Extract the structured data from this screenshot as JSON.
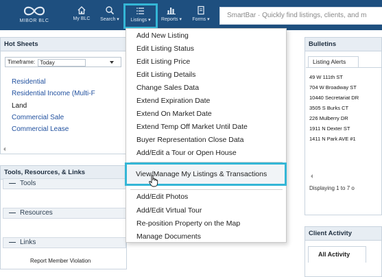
{
  "app": {
    "logo_text": "MIBOR BLC",
    "smartbar_placeholder": "SmartBar · Quickly find listings, clients, and m"
  },
  "nav": {
    "my_blc": "My BLC",
    "search": "Search ▾",
    "listings": "Listings ▾",
    "reports": "Reports ▾",
    "forms": "Forms ▾"
  },
  "hot_sheets": {
    "title": "Hot Sheets",
    "timeframe_label": "Timeframe:",
    "timeframe_value": "Today",
    "links": [
      "Residential",
      "Residential Income (Multi-F",
      "Land",
      "Commercial Sale",
      "Commercial Lease"
    ]
  },
  "tools": {
    "title": "Tools, Resources, & Links",
    "sections": [
      "Tools",
      "Resources",
      "Links"
    ],
    "collapse_symbol": "—",
    "report_link": "Report Member Violation"
  },
  "bulletins": {
    "title": "Bulletins",
    "tab": "Listing Alerts",
    "addresses": [
      "49 W 111th ST",
      "704 W Broadway ST",
      "10440 Secretariat DR",
      "3505 S Burks CT",
      "226 Mulberry DR",
      "1911 N Dexter ST",
      "1411 N Park AVE #1"
    ],
    "footer": "Displaying 1 to 7 o"
  },
  "client_activity": {
    "title": "Client Activity",
    "tab": "All Activity"
  },
  "listings_menu": {
    "group1": [
      "Add New Listing",
      "Edit Listing Status",
      "Edit Listing Price",
      "Edit Listing Details",
      "Change Sales Data",
      "Extend Expiration Date",
      "Extend On Market Date",
      "Extend Temp Off Market Until Date",
      "Buyer Representation Close Data",
      "Add/Edit a Tour or Open House"
    ],
    "highlighted": "View/Manage My Listings & Transactions",
    "group2": [
      "Add/Edit Photos",
      "Add/Edit Virtual Tour",
      "Re-position Property on the Map",
      "Manage Documents"
    ]
  },
  "colors": {
    "topbar": "#1e4f7f",
    "highlight": "#34b6d6",
    "link": "#1f4f9e"
  }
}
